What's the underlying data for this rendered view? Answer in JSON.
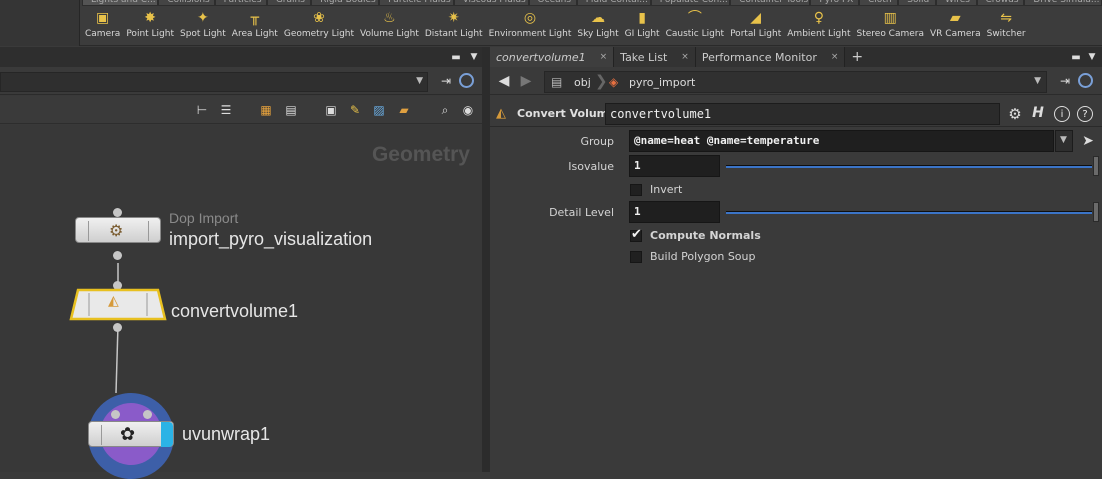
{
  "shelf": {
    "tabs": [
      "Lights and C...",
      "Collisions",
      "Particles",
      "Grains",
      "Rigid Bodies",
      "Particle Fluids",
      "Viscous Fluids",
      "Oceans",
      "Fluid Contai...",
      "Populate Con...",
      "Container Tools",
      "Pyro FX",
      "Cloth",
      "Solid",
      "Wires",
      "Crowds",
      "Drive Simula..."
    ],
    "tools": [
      {
        "label": "Camera",
        "icon": "camera-icon"
      },
      {
        "label": "Point Light",
        "icon": "point-light-icon"
      },
      {
        "label": "Spot Light",
        "icon": "spot-light-icon"
      },
      {
        "label": "Area Light",
        "icon": "area-light-icon"
      },
      {
        "label": "Geometry Light",
        "icon": "geometry-light-icon"
      },
      {
        "label": "Volume Light",
        "icon": "volume-light-icon"
      },
      {
        "label": "Distant Light",
        "icon": "distant-light-icon"
      },
      {
        "label": "Environment Light",
        "icon": "environment-light-icon"
      },
      {
        "label": "Sky Light",
        "icon": "sky-light-icon"
      },
      {
        "label": "GI Light",
        "icon": "gi-light-icon"
      },
      {
        "label": "Caustic Light",
        "icon": "caustic-light-icon"
      },
      {
        "label": "Portal Light",
        "icon": "portal-light-icon"
      },
      {
        "label": "Ambient Light",
        "icon": "ambient-light-icon"
      },
      {
        "label": "Stereo Camera",
        "icon": "stereo-camera-icon"
      },
      {
        "label": "VR Camera",
        "icon": "vr-camera-icon"
      },
      {
        "label": "Switcher",
        "icon": "switcher-icon"
      }
    ]
  },
  "network": {
    "context_label": "Geometry",
    "nodes": [
      {
        "type": "Dop Import",
        "name": "import_pyro_visualization"
      },
      {
        "type": "",
        "name": "convertvolume1"
      },
      {
        "type": "",
        "name": "uvunwrap1"
      }
    ]
  },
  "params": {
    "tabs": [
      {
        "label": "convertvolume1",
        "close": "×"
      },
      {
        "label": "Take List",
        "close": "×"
      },
      {
        "label": "Performance Monitor",
        "close": "×"
      }
    ],
    "add_tab": "+",
    "path": {
      "root": "obj",
      "node": "pyro_import"
    },
    "header": {
      "type_label": "Convert Volume",
      "node_name": "convertvolume1"
    },
    "group": {
      "label": "Group",
      "value": "@name=heat @name=temperature"
    },
    "isovalue": {
      "label": "Isovalue",
      "value": "1",
      "slider_fraction": 1.0
    },
    "invert": {
      "label": "Invert",
      "checked": false
    },
    "detail_level": {
      "label": "Detail Level",
      "value": "1",
      "slider_fraction": 1.0
    },
    "compute_normals": {
      "label": "Compute Normals",
      "checked": true
    },
    "build_polygon_soup": {
      "label": "Build Polygon Soup",
      "checked": false
    }
  },
  "colors": {
    "accent_blue": "#3b74c7",
    "selected_node_outline": "#e8c020",
    "uv_node_ring": "#3d5fa8",
    "uv_node_inner": "#8a5bc9",
    "uv_flag_cyan": "#2bb3e6"
  }
}
